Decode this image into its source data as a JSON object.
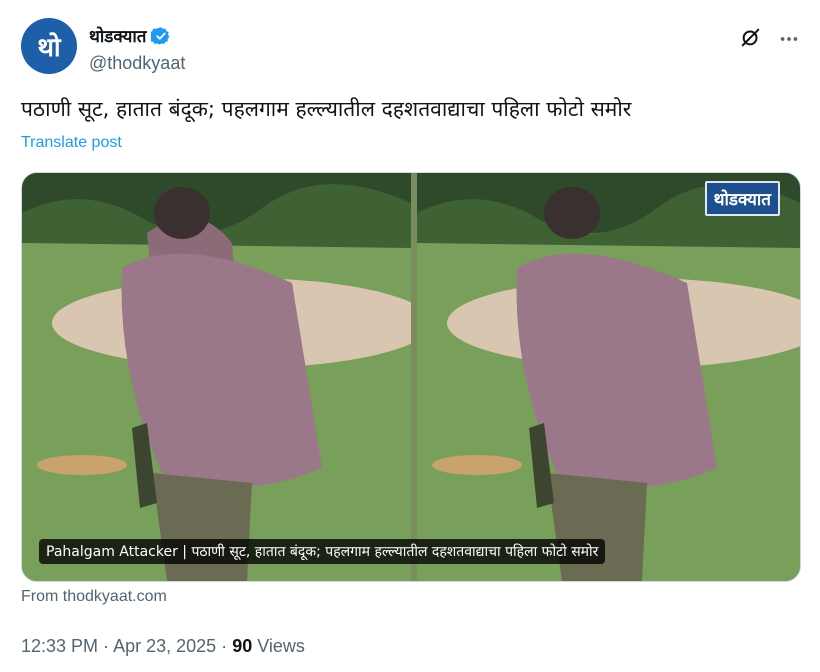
{
  "account": {
    "avatar_text": "थो",
    "display_name": "थोडक्यात",
    "handle": "@thodkyaat",
    "verified": true,
    "avatar_color": "#1d5fa8"
  },
  "header_icons": [
    "grok-icon",
    "more-icon"
  ],
  "tweet": {
    "text": "पठाणी सूट, हातात बंदूक; पहलगाम हल्ल्यातील दहशतवाद्याचा पहिला फोटो समोर",
    "translate_label": "Translate post"
  },
  "media": {
    "brand_badge": "थोडक्यात",
    "caption": "Pahalgam Attacker | पठाणी सूट, हातात बंदूक; पहलगाम हल्ल्यातील दहशतवाद्याचा पहिला फोटो समोर"
  },
  "source_label": "From thodkyaat.com",
  "meta": {
    "time": "12:33 PM",
    "sep1": "·",
    "date": "Apr 23, 2025",
    "sep2": "·",
    "views_count": "90",
    "views_label": "Views"
  },
  "colors": {
    "link": "#1d9bf0",
    "secondary_text": "#536471",
    "verified": "#1d9bf0"
  }
}
